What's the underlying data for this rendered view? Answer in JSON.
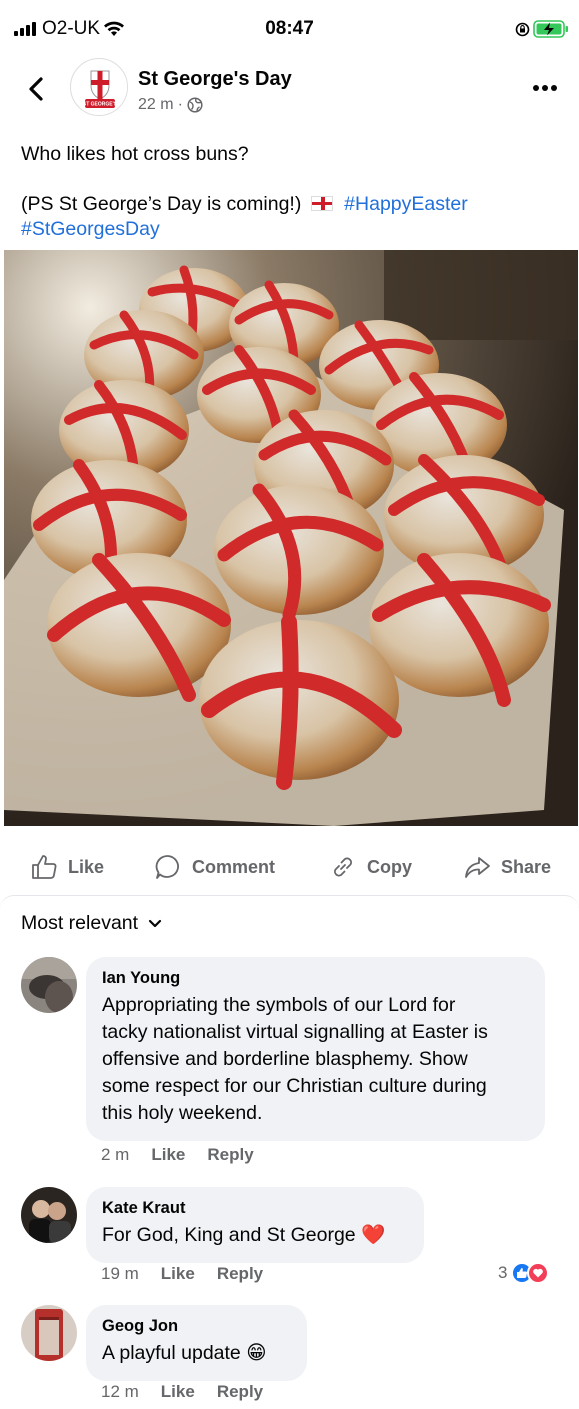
{
  "status_bar": {
    "carrier": "O2-UK",
    "time": "08:47"
  },
  "post": {
    "page_name": "St George's Day",
    "time_ago": "22 m",
    "separator": "·",
    "text_line1": "Who likes hot cross buns?",
    "text_line2_prefix": "(PS St George’s Day is coming!)",
    "hashtag1": "#HappyEaster",
    "hashtag2": "#StGeorgesDay",
    "avatar_text": "ST GEORGE'S DAY"
  },
  "actions": {
    "like": "Like",
    "comment": "Comment",
    "copy": "Copy",
    "share": "Share"
  },
  "comments_sort": "Most relevant",
  "comments": [
    {
      "name": "Ian Young",
      "lines": [
        "Appropriating the symbols of our Lord for",
        "tacky nationalist virtual signalling at Easter is",
        "offensive and borderline blasphemy. Show",
        "some respect for our Christian culture during",
        "this holy weekend."
      ],
      "time": "2 m",
      "like": "Like",
      "reply": "Reply"
    },
    {
      "name": "Kate Kraut",
      "lines": [
        "For God, King and St George"
      ],
      "emoji": "❤️",
      "time": "19 m",
      "like": "Like",
      "reply": "Reply",
      "reactions": "3"
    },
    {
      "name": "Geog Jon",
      "lines": [
        "A playful update"
      ],
      "emoji": "😁",
      "time": "12 m",
      "like": "Like",
      "reply": "Reply"
    }
  ],
  "colors": {
    "link": "#216fdb",
    "secondary": "#65676b",
    "bubble": "#f0f2f5",
    "cross": "#cf1c2b"
  }
}
